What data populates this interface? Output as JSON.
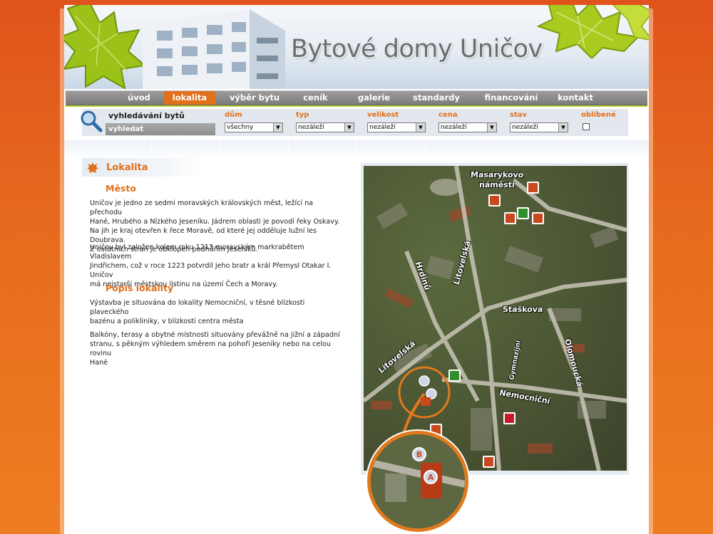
{
  "site": {
    "title": "Bytové domy Uničov"
  },
  "nav": {
    "items": [
      "úvod",
      "lokalita",
      "výběr bytu",
      "ceník",
      "galerie",
      "standardy",
      "financování",
      "kontakt"
    ],
    "active": "lokalita"
  },
  "search": {
    "title": "vyhledávání bytů",
    "button": "vyhledat",
    "filters": [
      {
        "label": "dům",
        "value": "všechny"
      },
      {
        "label": "typ",
        "value": "nezáleží"
      },
      {
        "label": "velikost",
        "value": "nezáleží"
      },
      {
        "label": "cena",
        "value": "nezáleží"
      },
      {
        "label": "stav",
        "value": "nezáleží"
      }
    ],
    "favorite_label": "oblíbené"
  },
  "content": {
    "section_title": "Lokalita",
    "mesto": {
      "heading": "Město",
      "p1": [
        "Uničov je jedno ze sedmi moravských královských měst, ležící na přechodu",
        "Hané, Hrubého a Nízkého Jeseníku. Jádrem oblasti je povodí řeky Oskavy.",
        "Na jih je kraj otevřen k řece Moravě, od které jej odděluje lužní les Doubrava.",
        "Z ostatních stran je obklopen podhůřím Jeseníků."
      ],
      "p2": [
        "Uničov byl založen kolem roku 1213 moravským markrabětem Vladislavem",
        "Jindřichem, což v roce 1223 potvrdil jeho bratr a král Přemysl Otakar I. Uničov",
        "má nejstarší městskou listinu na území Čech a Moravy."
      ]
    },
    "popis": {
      "heading": "Popis lokality",
      "p1": [
        "Výstavba je situována do lokality Nemocniční, v těsné blízkosti plaveckého",
        "bazénu a polikliniky, v blízkosti centra města"
      ],
      "p2": [
        "Balkóny, terasy a obytné místnosti situovány převážně na jižní a západní",
        "stranu, s pěkným výhledem směrem na pohoří Jeseníky nebo na celou rovinu",
        "Hané"
      ]
    }
  },
  "map": {
    "streets": [
      "Masarykovo",
      "náměstí",
      "Litovelská",
      "Hrdinů",
      "Staškova",
      "Gymnazijní",
      "Olomoucká",
      "Litovelská",
      "Nemocniční"
    ],
    "markers": [
      "B",
      "A"
    ]
  },
  "colors": {
    "accent": "#e0701c",
    "nav": "#8a8a8a",
    "green": "#b7d435"
  }
}
